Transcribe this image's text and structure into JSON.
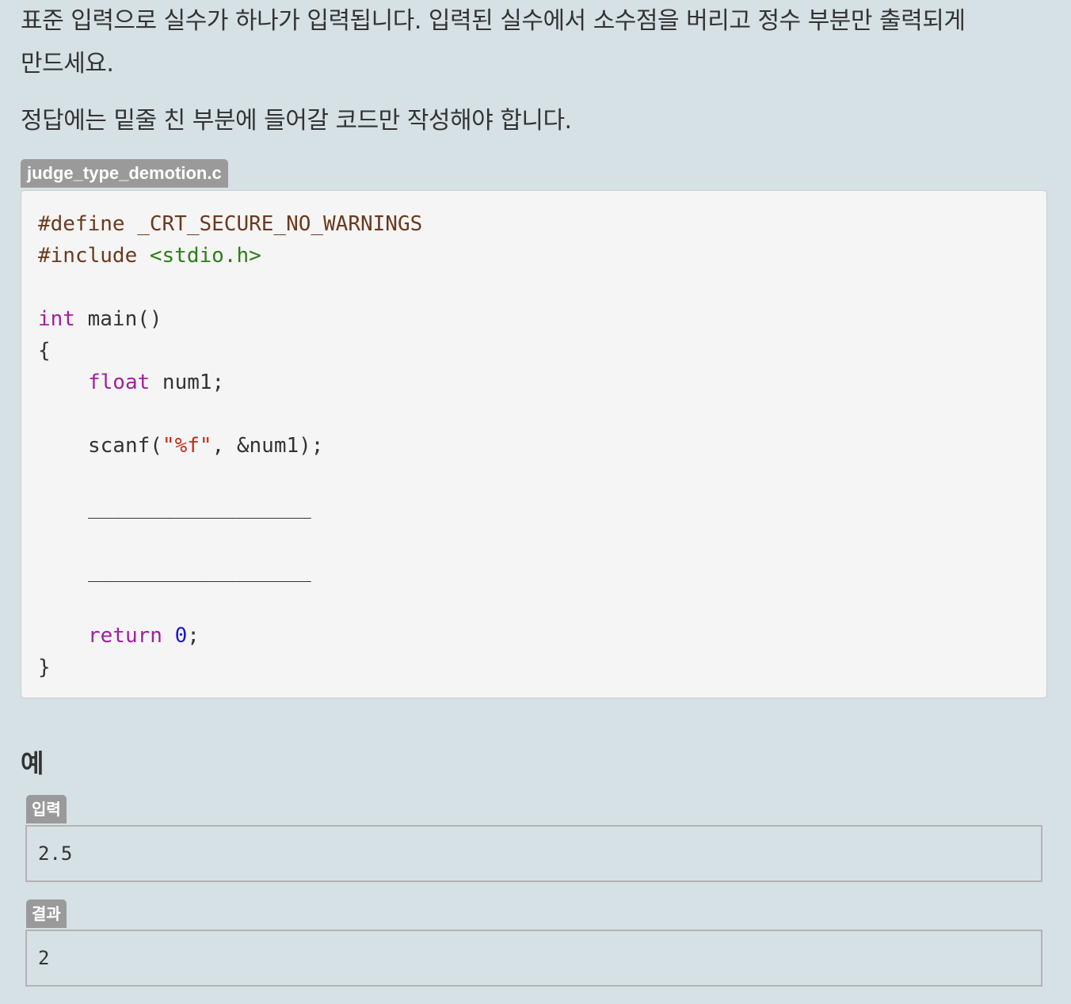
{
  "problem": {
    "line1": "표준 입력으로 실수가 하나가 입력됩니다. 입력된 실수에서 소수점을 버리고 정수 부분만 출력되게",
    "line2": "만드세요.",
    "line3": "정답에는 밑줄 친 부분에 들어갈 코드만 작성해야 합니다."
  },
  "code": {
    "filename": "judge_type_demotion.c",
    "l1": "#define _CRT_SECURE_NO_WARNINGS",
    "l2_directive": "#include ",
    "l2_header": "<stdio.h>",
    "l4_type": "int",
    "l4_rest": " main()",
    "l5": "{",
    "l6_type": "float",
    "l6_rest": " num1;",
    "l8_pre": "scanf(",
    "l8_str": "\"%f\"",
    "l8_post": ", &num1);",
    "blank1": "__________________",
    "blank2": "__________________",
    "l14_kw": "return",
    "l14_num": "0",
    "l14_post": ";",
    "l15": "}"
  },
  "example": {
    "heading": "예",
    "input_label": "입력",
    "input_value": "2.5",
    "output_label": "결과",
    "output_value": "2"
  }
}
